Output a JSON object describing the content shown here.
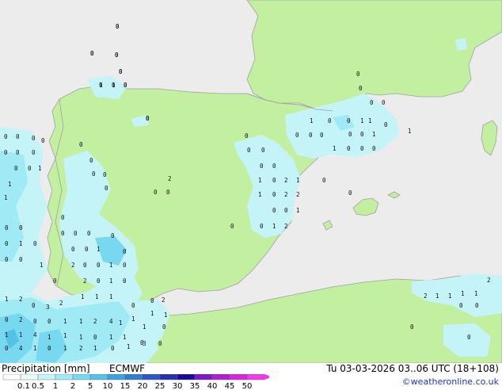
{
  "map": {
    "colors": {
      "sea": "#ececec",
      "land": "#c3f0a0",
      "border": "#a0a0a0"
    },
    "labels": [
      "0",
      "0",
      "0",
      "0",
      "0",
      "1",
      "0",
      "0",
      "0",
      "0",
      "0",
      "0",
      "0",
      "1",
      "0",
      "0",
      "0",
      "0",
      "0",
      "1",
      "0",
      "0",
      "1",
      "1",
      "0",
      "0",
      "0",
      "0",
      "0",
      "0",
      "0",
      "1",
      "0",
      "1",
      "0",
      "0",
      "0",
      "0",
      "0",
      "0",
      "0",
      "0",
      "0",
      "1",
      "1",
      "1",
      "1",
      "0",
      "2",
      "1",
      "1",
      "0",
      "2",
      "2",
      "0",
      "0",
      "1",
      "0",
      "1",
      "2",
      "0",
      "0",
      "0",
      "2",
      "0",
      "0",
      "0",
      "0",
      "0",
      "0",
      "0",
      "0",
      "0",
      "0",
      "0",
      "0",
      "0",
      "0",
      "0",
      "1",
      "0",
      "0",
      "0",
      "0",
      "0",
      "1",
      "0",
      "2",
      "0",
      "0",
      "1",
      "0",
      "2",
      "0",
      "1",
      "0",
      "0",
      "1",
      "1",
      "2",
      "0",
      "3",
      "2",
      "1",
      "1",
      "1",
      "0",
      "2",
      "0",
      "0",
      "1",
      "1",
      "2",
      "4",
      "1",
      "1",
      "1",
      "4",
      "1",
      "1",
      "1",
      "0",
      "1",
      "1",
      "0",
      "4",
      "1",
      "0",
      "1",
      "2",
      "1",
      "0",
      "1",
      "0",
      "0",
      "2",
      "1",
      "1",
      "0",
      "1",
      "1",
      "0",
      "3",
      "0",
      "2",
      "1",
      "1",
      "1",
      "1",
      "2",
      "0",
      "0",
      "0",
      "0",
      "0",
      "0",
      "0",
      "0",
      "1",
      "0",
      "0",
      "0"
    ]
  },
  "legend": {
    "title": "Precipitation [mm]",
    "model": "ECMWF",
    "datetime": "Tu 03-03-2026 03..06 UTC (18+108)",
    "credit": "©weatheronline.co.uk",
    "ticks": [
      "0.1",
      "0.5",
      "1",
      "2",
      "5",
      "10",
      "15",
      "20",
      "25",
      "30",
      "35",
      "40",
      "45",
      "50"
    ],
    "colors": [
      "#fdfdfd",
      "#e8fbfb",
      "#c4f4f8",
      "#9feaf4",
      "#78d8ef",
      "#52c3e6",
      "#3ca2dc",
      "#2f7fd0",
      "#2a58c4",
      "#2430b0",
      "#1a0b99",
      "#7d17c8",
      "#b11fd3",
      "#d826d8",
      "#f23ae6"
    ]
  }
}
